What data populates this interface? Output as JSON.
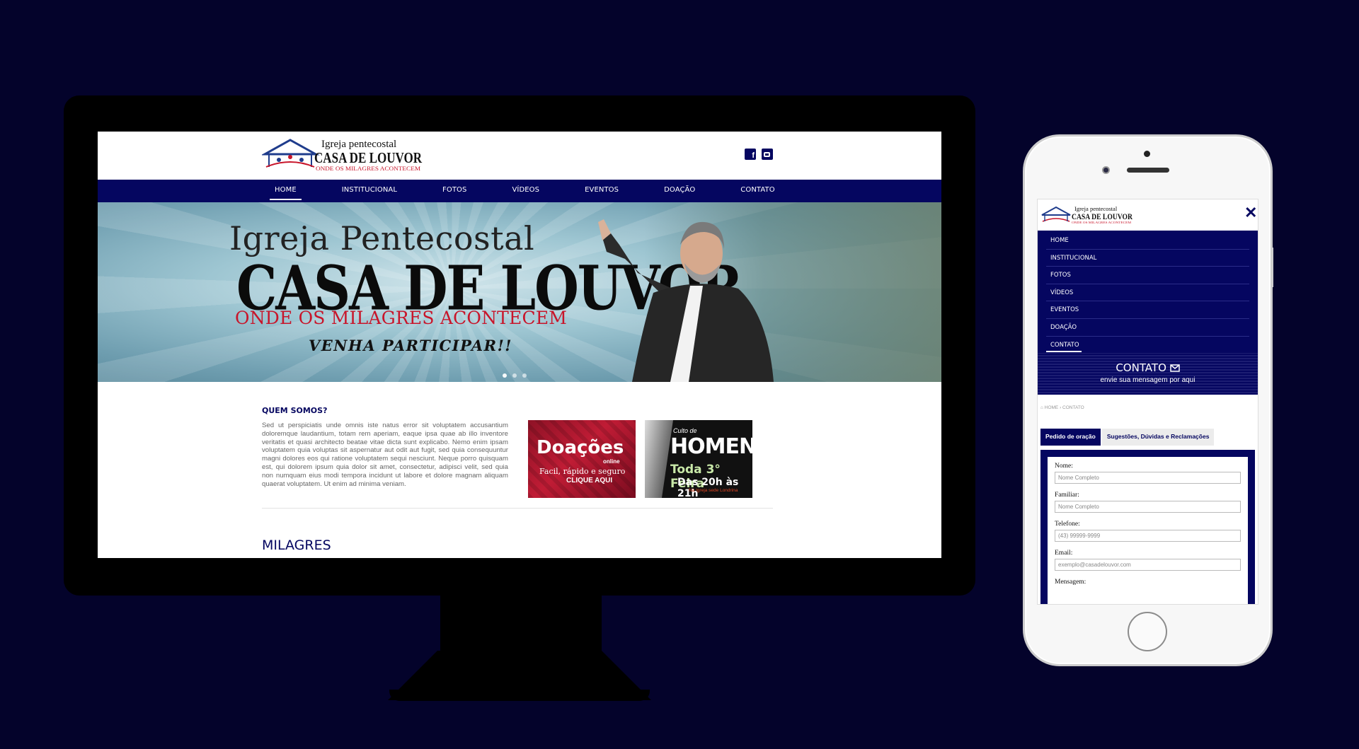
{
  "desktop": {
    "logo": {
      "line1": "Igreja pentecostal",
      "line2": "CASA DE LOUVOR",
      "tagline": "ONDE OS MILAGRES ACONTECEM"
    },
    "social": {
      "facebook": "facebook-icon",
      "youtube": "youtube-icon"
    },
    "nav": [
      "HOME",
      "INSTITUCIONAL",
      "FOTOS",
      "VÍDEOS",
      "EVENTOS",
      "DOAÇÃO",
      "CONTATO"
    ],
    "nav_active": "HOME",
    "hero": {
      "line1": "Igreja Pentecostal",
      "line2": "CASA DE LOUVOR",
      "line3": "ONDE OS MILAGRES ACONTECEM",
      "line4": "VENHA PARTICIPAR!!",
      "slides": 3
    },
    "about": {
      "title": "QUEM SOMOS?",
      "text": "Sed ut perspiciatis unde omnis iste natus error sit voluptatem accusantium doloremque laudantium, totam rem aperiam, eaque ipsa quae ab illo inventore veritatis et quasi architecto beatae vitae dicta sunt explicabo. Nemo enim ipsam voluptatem quia voluptas sit aspernatur aut odit aut fugit, sed quia consequuntur magni dolores eos qui ratione voluptatem sequi nesciunt. Neque porro quisquam est, qui dolorem ipsum quia dolor sit amet, consectetur, adipisci velit, sed quia non numquam eius modi tempora incidunt ut labore et dolore magnam aliquam quaerat voluptatem. Ut enim ad minima veniam."
    },
    "banner_donation": {
      "title": "Doações",
      "sub": "online",
      "desc": "Facil, rápido e seguro",
      "cta": "CLIQUE AQUI"
    },
    "banner_men": {
      "pre": "Culto de",
      "title": "HOMENS",
      "day": "Toda 3° Feira",
      "time": "Das 20h às 21h",
      "place": "Na Igreja sede Londrina"
    },
    "section_title": "MILAGRES"
  },
  "mobile": {
    "close": "✕",
    "nav": [
      "HOME",
      "INSTITUCIONAL",
      "FOTOS",
      "VÍDEOS",
      "EVENTOS",
      "DOAÇÃO",
      "CONTATO"
    ],
    "nav_active": "CONTATO",
    "contact_title": "CONTATO",
    "contact_sub": "envie sua mensagem por aqui",
    "breadcrumb": {
      "home": "HOME",
      "sep": "›",
      "current": "CONTATO"
    },
    "tabs": [
      "Pedido de oração",
      "Sugestões, Dúvidas e Reclamações"
    ],
    "form": {
      "nome_label": "Nome:",
      "nome_placeholder": "Nome Completo",
      "familiar_label": "Familiar:",
      "familiar_placeholder": "Nome Completo",
      "telefone_label": "Telefone:",
      "telefone_placeholder": "(43) 99999-9999",
      "email_label": "Email:",
      "email_placeholder": "exemplo@casadelouvor.com",
      "mensagem_label": "Mensagem:"
    }
  },
  "colors": {
    "background": "#04032b",
    "brand": "#050660",
    "accent_red": "#c8152a"
  }
}
